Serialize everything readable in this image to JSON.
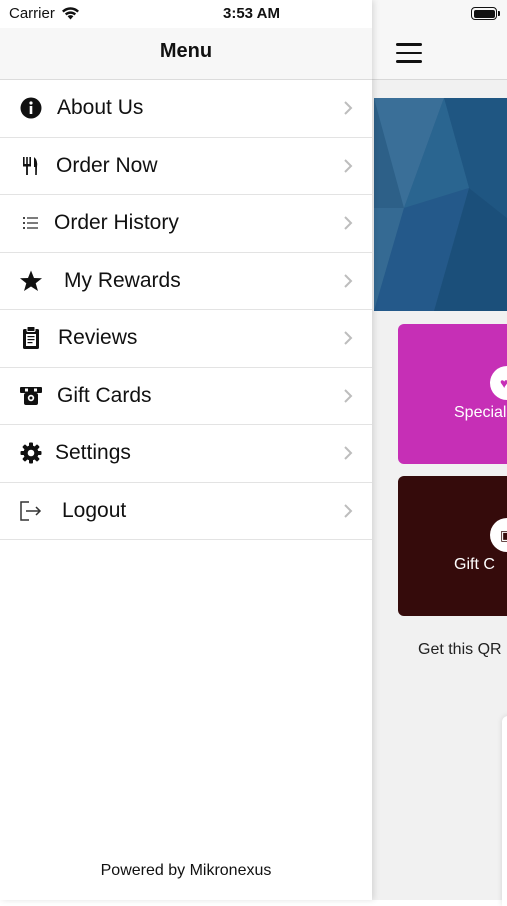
{
  "status_bar": {
    "carrier": "Carrier",
    "time": "3:53 AM"
  },
  "menu": {
    "title": "Menu",
    "items": [
      {
        "label": "About Us",
        "icon": "info-icon"
      },
      {
        "label": "Order Now",
        "icon": "utensils-icon"
      },
      {
        "label": "Order History",
        "icon": "list-icon"
      },
      {
        "label": "My Rewards",
        "icon": "star-icon"
      },
      {
        "label": "Reviews",
        "icon": "clipboard-icon"
      },
      {
        "label": "Gift Cards",
        "icon": "gift-card-icon"
      },
      {
        "label": "Settings",
        "icon": "gear-icon"
      },
      {
        "label": "Logout",
        "icon": "logout-icon"
      }
    ],
    "footer": "Powered by Mikronexus"
  },
  "background_screen": {
    "specials_label": "Special",
    "gift_label": "Gift C",
    "qr_text": "Get this QR",
    "colors": {
      "banner": "#2d6088",
      "specials": "#c62fb6",
      "gift": "#350b0b"
    }
  }
}
